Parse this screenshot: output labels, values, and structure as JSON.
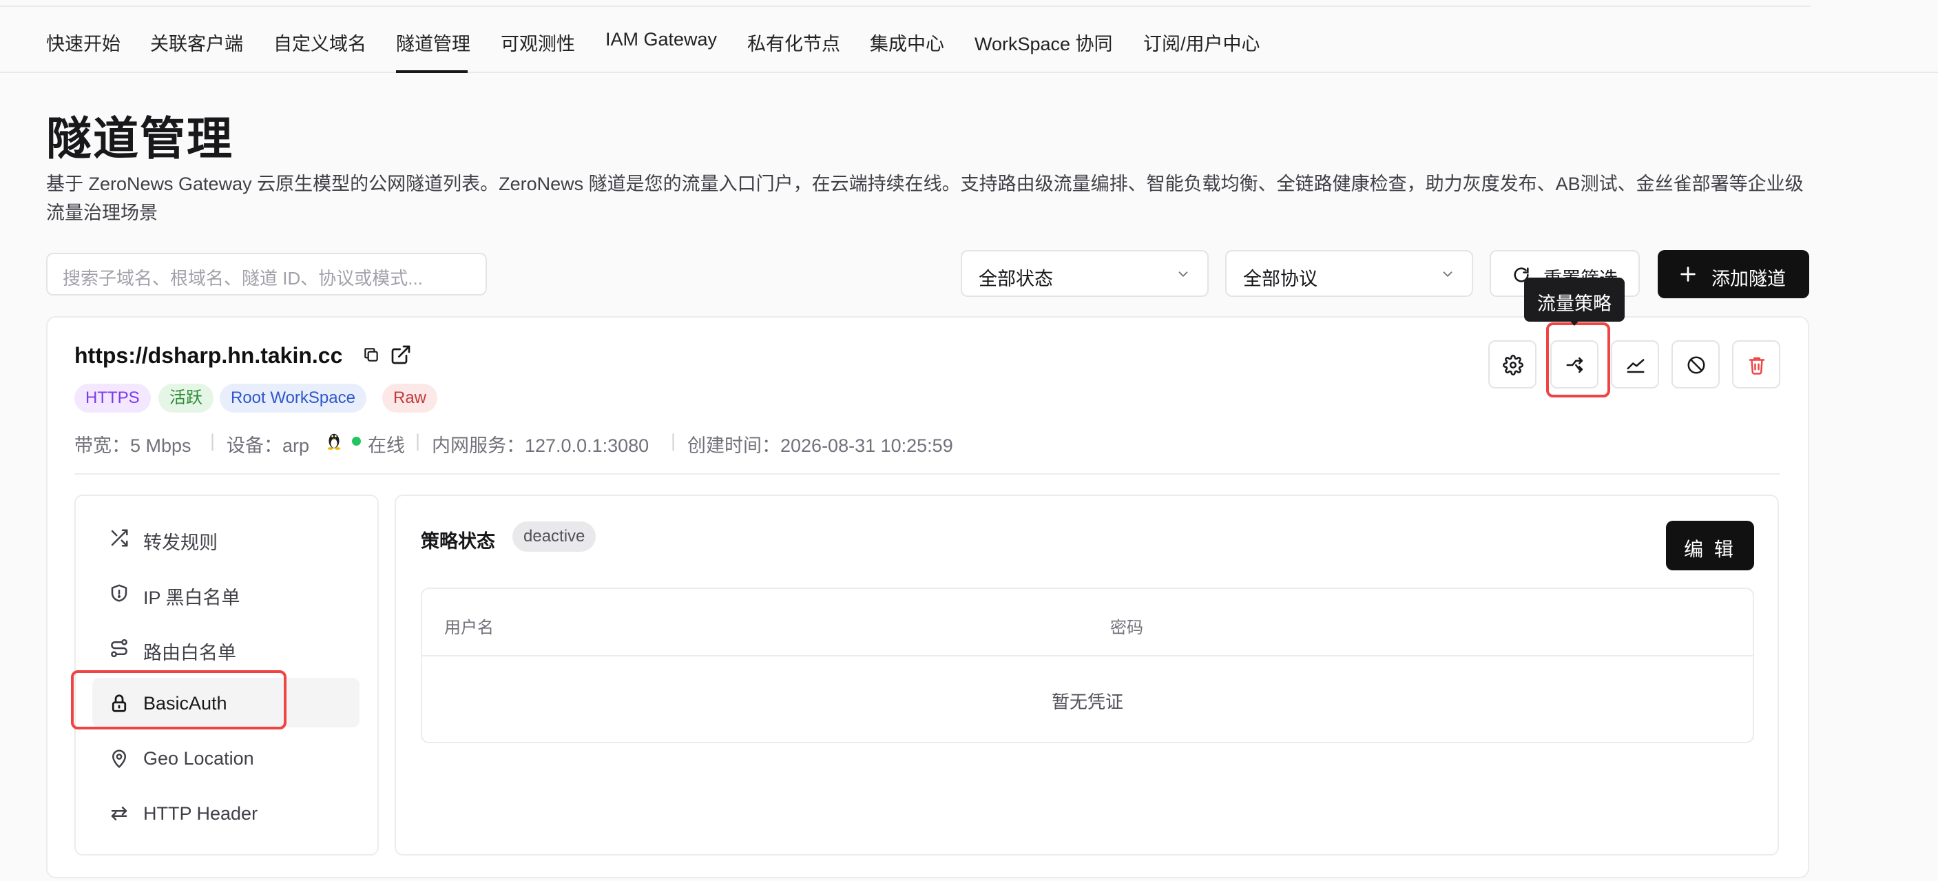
{
  "nav": {
    "items": [
      {
        "label": "快速开始"
      },
      {
        "label": "关联客户端"
      },
      {
        "label": "自定义域名"
      },
      {
        "label": "隧道管理",
        "active": true
      },
      {
        "label": "可观测性"
      },
      {
        "label": "IAM Gateway"
      },
      {
        "label": "私有化节点"
      },
      {
        "label": "集成中心"
      },
      {
        "label": "WorkSpace 协同"
      },
      {
        "label": "订阅/用户中心"
      }
    ]
  },
  "page": {
    "title": "隧道管理",
    "description": "基于 ZeroNews Gateway 云原生模型的公网隧道列表。ZeroNews 隧道是您的流量入口门户，在云端持续在线。支持路由级流量编排、智能负载均衡、全链路健康检查，助力灰度发布、AB测试、金丝雀部署等企业级流量治理场景"
  },
  "toolbar": {
    "search_placeholder": "搜索子域名、根域名、隧道 ID、协议或模式...",
    "status_select": "全部状态",
    "protocol_select": "全部协议",
    "reset_label": "重置筛选",
    "add_label": "添加隧道",
    "tooltip": "流量策略"
  },
  "tunnel": {
    "url": "https://dsharp.hn.takin.cc",
    "badges": {
      "protocol": "HTTPS",
      "state": "活跃",
      "workspace": "Root WorkSpace",
      "mode": "Raw"
    },
    "meta": {
      "bandwidth": "带宽：5 Mbps",
      "device_label": "设备：arp",
      "online": "在线",
      "service": "内网服务：127.0.0.1:3080",
      "created": "创建时间：2026-08-31 10:25:59",
      "sep": "|"
    }
  },
  "menu": {
    "items": [
      {
        "label": "转发规则",
        "icon": "shuffle-icon"
      },
      {
        "label": "IP 黑白名单",
        "icon": "shield-icon"
      },
      {
        "label": "路由白名单",
        "icon": "route-icon"
      },
      {
        "label": "BasicAuth",
        "icon": "lock-icon",
        "active": true
      },
      {
        "label": "Geo Location",
        "icon": "location-pin-icon"
      },
      {
        "label": "HTTP Header",
        "icon": "swap-arrows-icon"
      }
    ]
  },
  "content": {
    "policy_label": "策略状态",
    "policy_status": "deactive",
    "edit_label": "编 辑",
    "table": {
      "col_username": "用户名",
      "col_password": "密码",
      "empty": "暂无凭证"
    }
  },
  "colors": {
    "accent": "#111111",
    "highlight": "#ef4444",
    "online": "#22c55e"
  }
}
